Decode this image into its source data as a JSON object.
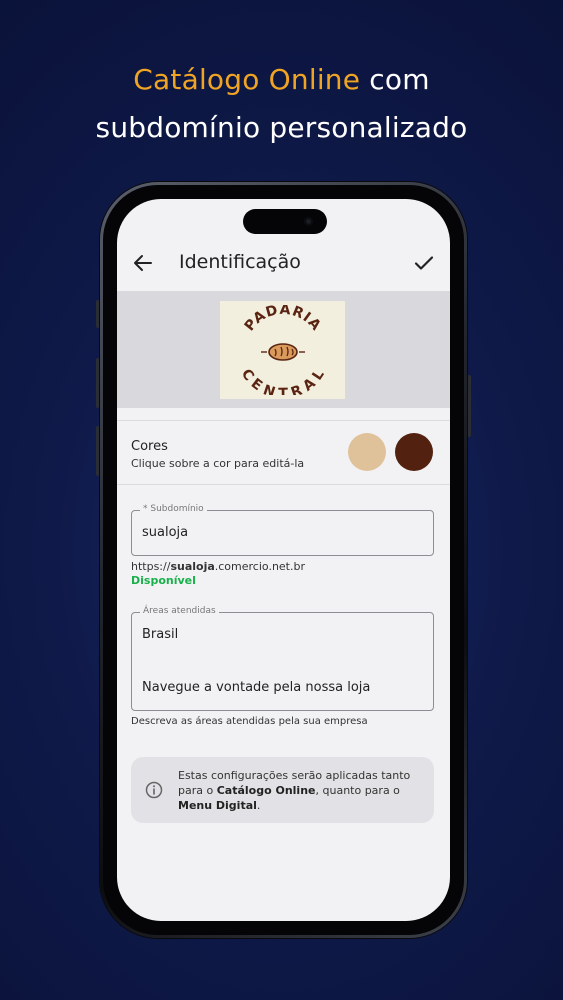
{
  "headline": {
    "accent": "Catálogo Online",
    "rest_line1": " com",
    "line2": "subdomínio personalizado"
  },
  "appbar": {
    "back_icon": "arrow-left-icon",
    "title": "Identificação",
    "confirm_icon": "check-icon"
  },
  "logo": {
    "top_text": "PADARIA",
    "bottom_text": "CENTRAL"
  },
  "colors_section": {
    "label": "Cores",
    "hint": "Clique sobre a cor para editá-la",
    "swatches": [
      "#e0c29a",
      "#52210f"
    ]
  },
  "subdomain": {
    "legend": "* Subdomínio",
    "value": "sualoja",
    "url_prefix": "https://",
    "url_bold": "sualoja",
    "url_suffix": ".comercio.net.br",
    "status": "Disponível"
  },
  "areas": {
    "legend": "Áreas atendidas",
    "line1": "Brasil",
    "line2": "Navegue a vontade pela nossa loja",
    "hint": "Descreva as áreas atendidas pela sua empresa"
  },
  "info": {
    "icon": "info-circle-icon",
    "text_a": "Estas configurações serão aplicadas tanto para o ",
    "bold_a": "Catálogo Online",
    "text_b": ", quanto para o ",
    "bold_b": "Menu Digital",
    "text_c": "."
  }
}
